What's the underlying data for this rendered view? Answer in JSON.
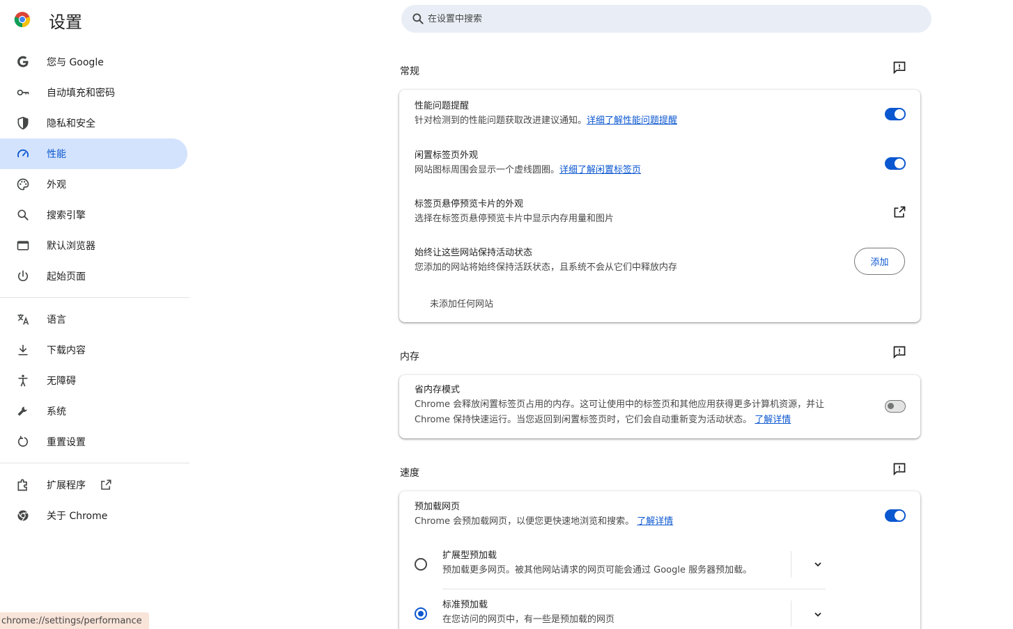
{
  "header": {
    "title": "设置",
    "search_placeholder": "在设置中搜索"
  },
  "sidebar": {
    "items": [
      {
        "label": "您与 Google",
        "icon": "google-g-icon"
      },
      {
        "label": "自动填充和密码",
        "icon": "key-icon"
      },
      {
        "label": "隐私和安全",
        "icon": "shield-icon"
      },
      {
        "label": "性能",
        "icon": "speedometer-icon",
        "active": true
      },
      {
        "label": "外观",
        "icon": "palette-icon"
      },
      {
        "label": "搜索引擎",
        "icon": "search-icon"
      },
      {
        "label": "默认浏览器",
        "icon": "browser-window-icon"
      },
      {
        "label": "起始页面",
        "icon": "power-icon"
      }
    ],
    "items2": [
      {
        "label": "语言",
        "icon": "translate-icon"
      },
      {
        "label": "下载内容",
        "icon": "download-icon"
      },
      {
        "label": "无障碍",
        "icon": "accessibility-icon"
      },
      {
        "label": "系统",
        "icon": "wrench-icon"
      },
      {
        "label": "重置设置",
        "icon": "reset-icon"
      }
    ],
    "items3": [
      {
        "label": "扩展程序",
        "icon": "puzzle-icon"
      },
      {
        "label": "关于 Chrome",
        "icon": "chrome-icon"
      }
    ]
  },
  "general": {
    "title": "常规",
    "perf_alert": {
      "label": "性能问题提醒",
      "desc": "针对检测到的性能问题获取改进建议通知。",
      "link": "详细了解性能问题提醒",
      "enabled": true
    },
    "inactive_tab": {
      "label": "闲置标签页外观",
      "desc": "网站图标周围会显示一个虚线圆圈。",
      "link": "详细了解闲置标签页",
      "enabled": true
    },
    "hover_card": {
      "label": "标签页悬停预览卡片的外观",
      "desc": "选择在标签页悬停预览卡片中显示内存用量和图片"
    },
    "keep_active": {
      "label": "始终让这些网站保持活动状态",
      "desc": "您添加的网站将始终保持活跃状态，且系统不会从它们中释放内存",
      "button": "添加",
      "empty": "未添加任何网站"
    }
  },
  "memory": {
    "title": "内存",
    "saver": {
      "label": "省内存模式",
      "desc1": "Chrome 会释放闲置标签页占用的内存。这可让使用中的标签页和其他应用获得更多计算机资源，并让",
      "desc2": "Chrome 保持快速运行。当您返回到闲置标签页时，它们会自动重新变为活动状态。",
      "link": "了解详情",
      "enabled": false
    }
  },
  "speed": {
    "title": "速度",
    "preload": {
      "label": "预加载网页",
      "desc": "Chrome 会预加载网页，以便您更快速地浏览和搜索。",
      "link": "了解详情",
      "enabled": true
    },
    "extended": {
      "label": "扩展型预加载",
      "desc": "预加载更多网页。被其他网站请求的网页可能会通过 Google 服务器预加载。",
      "checked": false
    },
    "standard": {
      "label": "标准预加载",
      "desc": "在您访问的网页中，有一些是预加载的网页",
      "checked": true
    }
  },
  "status_bar": {
    "url": "chrome://settings/performance"
  },
  "colors": {
    "accent": "#0b57d0",
    "active_nav_bg": "#d3e3fd",
    "search_bg": "#e9eef6"
  }
}
